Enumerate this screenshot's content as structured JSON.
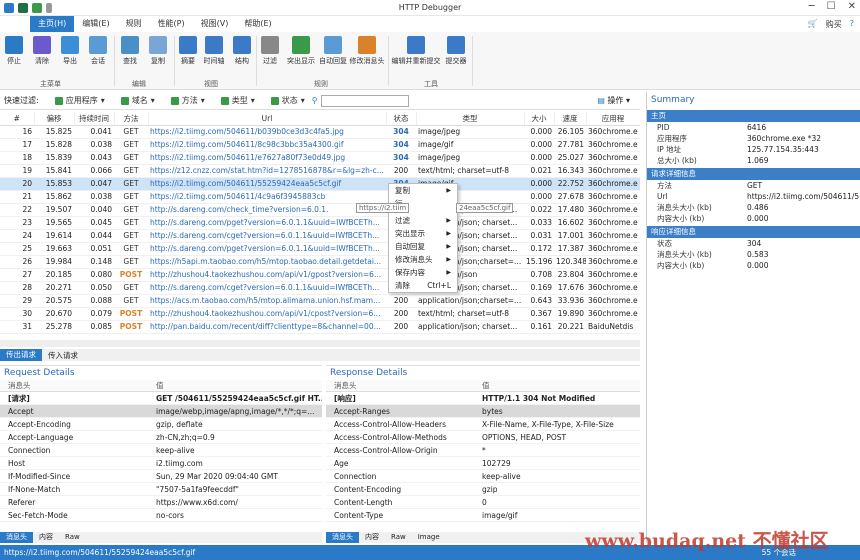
{
  "window": {
    "title": "HTTP Debugger",
    "buy": "购买",
    "help": "?"
  },
  "menu": {
    "items": [
      {
        "label": "主页(H)",
        "active": true
      },
      {
        "label": "编辑(E)"
      },
      {
        "label": "规则"
      },
      {
        "label": "性能(P)"
      },
      {
        "label": "视图(V)"
      },
      {
        "label": "帮助(E)"
      }
    ]
  },
  "ribbon": {
    "buttons": [
      "停止",
      "清除",
      "导出",
      "会话",
      "查找",
      "复制",
      "摘要",
      "时间轴",
      "结构",
      "过滤",
      "突出显示",
      "自动回复",
      "修改消息头",
      "编辑并重新提交",
      "提交器"
    ],
    "groups": [
      "主菜单",
      "编辑",
      "视图",
      "规则",
      "工具"
    ]
  },
  "filter": {
    "label": "快速过滤:",
    "app": "应用程序",
    "domain": "域名",
    "method": "方法",
    "type": "类型",
    "status": "状态",
    "ops": "操作"
  },
  "grid": {
    "headers": [
      "#",
      "偏移",
      "持续时间",
      "方法",
      "Url",
      "状态",
      "类型",
      "大小",
      "速度",
      "应用程"
    ],
    "rows": [
      [
        "16",
        "15.825",
        "0.041",
        "GET",
        "https://i2.tiimg.com/504611/b039b0ce3d3c4fa5.jpg",
        "304",
        "image/jpeg",
        "0.000",
        "26.105",
        "360chrome.e"
      ],
      [
        "17",
        "15.828",
        "0.038",
        "GET",
        "https://i2.tiimg.com/504611/8c98c3bbc35a4300.gif",
        "304",
        "image/gif",
        "0.000",
        "27.781",
        "360chrome.e"
      ],
      [
        "18",
        "15.839",
        "0.043",
        "GET",
        "https://i2.tiimg.com/504611/e7627a80f73e0d49.jpg",
        "304",
        "image/jpeg",
        "0.000",
        "25.027",
        "360chrome.e"
      ],
      [
        "19",
        "15.841",
        "0.066",
        "GET",
        "https://z12.cnzz.com/stat.htm?id=1278516878&r=&lg=zh-c...",
        "200",
        "text/html; charset=utf-8",
        "0.021",
        "16.343",
        "360chrome.e"
      ],
      [
        "20",
        "15.853",
        "0.047",
        "GET",
        "https://i2.tiimg.com/504611/55259424eaa5c5cf.gif",
        "304",
        "image/gif",
        "0.000",
        "22.752",
        "360chrome.e"
      ],
      [
        "21",
        "15.862",
        "0.038",
        "GET",
        "https://i2.tiimg.com/504611/4c9a6f3945883cb",
        "304",
        "image/gif",
        "0.000",
        "27.678",
        "360chrome.e"
      ],
      [
        "22",
        "19.507",
        "0.040",
        "GET",
        "http://s.dareng.com/check_time?version=6.0.1.",
        "200",
        "application/json; charset...",
        "0.022",
        "17.480",
        "360chrome.e"
      ],
      [
        "23",
        "19.565",
        "0.045",
        "GET",
        "http://s.dareng.com/pget?version=6.0.1.1&uuid=IWfBCETh...",
        "200",
        "application/json; charset...",
        "0.033",
        "16.602",
        "360chrome.e"
      ],
      [
        "24",
        "19.614",
        "0.044",
        "GET",
        "http://s.dareng.com/cget?version=6.0.1.1&uuid=IWfBCETh...",
        "200",
        "application/json; charset...",
        "0.031",
        "17.001",
        "360chrome.e"
      ],
      [
        "25",
        "19.663",
        "0.051",
        "GET",
        "http://s.dareng.com/pget?version=6.0.1.1&uuid=IWfBCETh...",
        "200",
        "application/json; charset...",
        "0.172",
        "17.387",
        "360chrome.e"
      ],
      [
        "26",
        "19.984",
        "0.148",
        "GET",
        "https://h5api.m.taobao.com/h5/mtop.taobao.detail.getdetai...",
        "200",
        "application/json;charset=...",
        "15.196",
        "120.348",
        "360chrome.e"
      ],
      [
        "27",
        "20.185",
        "0.080",
        "POST",
        "http://zhushou4.taokezhushou.com/api/v1/gpost?version=6...",
        "200",
        "application/json",
        "0.708",
        "23.804",
        "360chrome.e"
      ],
      [
        "28",
        "20.271",
        "0.050",
        "GET",
        "http://s.dareng.com/cget?version=6.0.1.1&uuid=IWfBCETh...",
        "200",
        "application/json; charset...",
        "0.169",
        "17.676",
        "360chrome.e"
      ],
      [
        "29",
        "20.575",
        "0.088",
        "GET",
        "https://acs.m.taobao.com/h5/mtop.alimama.union.hsf.mam...",
        "200",
        "application/json;charset=...",
        "0.643",
        "33.936",
        "360chrome.e"
      ],
      [
        "30",
        "20.670",
        "0.079",
        "POST",
        "http://zhushou4.taokezhushou.com/api/v1/cpost?version=6...",
        "200",
        "text/html; charset=utf-8",
        "0.367",
        "19.890",
        "360chrome.e"
      ],
      [
        "31",
        "25.278",
        "0.085",
        "POST",
        "http://pan.baidu.com/recent/diff?clienttype=8&channel=00...",
        "200",
        "application/json; charset...",
        "0.161",
        "20.221",
        "BaiduNetdis"
      ]
    ]
  },
  "context_menu": {
    "items": [
      "复制",
      "行",
      "过滤",
      "突出显示",
      "自动回复",
      "修改消息头",
      "保存内容",
      "清除"
    ],
    "shortcut": "Ctrl+L"
  },
  "tooltip": "https://i2.tiim",
  "tooltip_tail": "24eaa5c5cf.gif",
  "bottom_tabs": {
    "items": [
      "传出请求",
      "传入请求"
    ]
  },
  "request": {
    "title": "Request Details",
    "headers": [
      "消息头",
      "值"
    ],
    "rows": [
      [
        "[请求]",
        "GET /504611/55259424eaa5c5cf.gif HT..."
      ],
      [
        "Accept",
        "image/webp,image/apng,image/*,*/*;q=..."
      ],
      [
        "Accept-Encoding",
        "gzip, deflate"
      ],
      [
        "Accept-Language",
        "zh-CN,zh;q=0.9"
      ],
      [
        "Connection",
        "keep-alive"
      ],
      [
        "Host",
        "i2.tiimg.com"
      ],
      [
        "If-Modified-Since",
        "Sun, 29 Mar 2020 09:04:40 GMT"
      ],
      [
        "If-None-Match",
        "\"7507-5a1fa9feecddf\""
      ],
      [
        "Referer",
        "https://www.x6d.com/"
      ],
      [
        "Sec-Fetch-Mode",
        "no-cors"
      ]
    ],
    "tabs": [
      "消息头",
      "内容",
      "Raw"
    ]
  },
  "response": {
    "title": "Response Details",
    "headers": [
      "消息头",
      "值"
    ],
    "rows": [
      [
        "[响应]",
        "HTTP/1.1 304 Not Modified"
      ],
      [
        "Accept-Ranges",
        "bytes"
      ],
      [
        "Access-Control-Allow-Headers",
        "X-File-Name, X-File-Type, X-File-Size"
      ],
      [
        "Access-Control-Allow-Methods",
        "OPTIONS, HEAD, POST"
      ],
      [
        "Access-Control-Allow-Origin",
        "*"
      ],
      [
        "Age",
        "102729"
      ],
      [
        "Connection",
        "keep-alive"
      ],
      [
        "Content-Encoding",
        "gzip"
      ],
      [
        "Content-Length",
        "0"
      ],
      [
        "Content-Type",
        "image/gif"
      ]
    ],
    "tabs": [
      "消息头",
      "内容",
      "Raw",
      "Image"
    ]
  },
  "summary": {
    "title": "Summary",
    "groups": [
      {
        "name": "主页",
        "rows": [
          [
            "PID",
            "6416"
          ],
          [
            "应用程序",
            "360chrome.exe *32"
          ],
          [
            "IP 地址",
            "125.77.154.35:443"
          ],
          [
            "总大小 (kb)",
            "1.069"
          ]
        ]
      },
      {
        "name": "请求详细信息",
        "rows": [
          [
            "方法",
            "GET"
          ],
          [
            "Url",
            "https://i2.tiimg.com/504611/5"
          ],
          [
            "消息头大小 (kb)",
            "0.486"
          ],
          [
            "内容大小 (kb)",
            "0.000"
          ]
        ]
      },
      {
        "name": "响应详细信息",
        "rows": [
          [
            "状态",
            "304"
          ],
          [
            "消息头大小 (kb)",
            "0.583"
          ],
          [
            "内容大小 (kb)",
            "0.000"
          ]
        ]
      }
    ]
  },
  "status": {
    "url": "https://i2.tiimg.com/504611/55259424eaa5c5cf.gif",
    "count": "55 个会话"
  },
  "watermark": "www.budaq.net 不懂社区"
}
